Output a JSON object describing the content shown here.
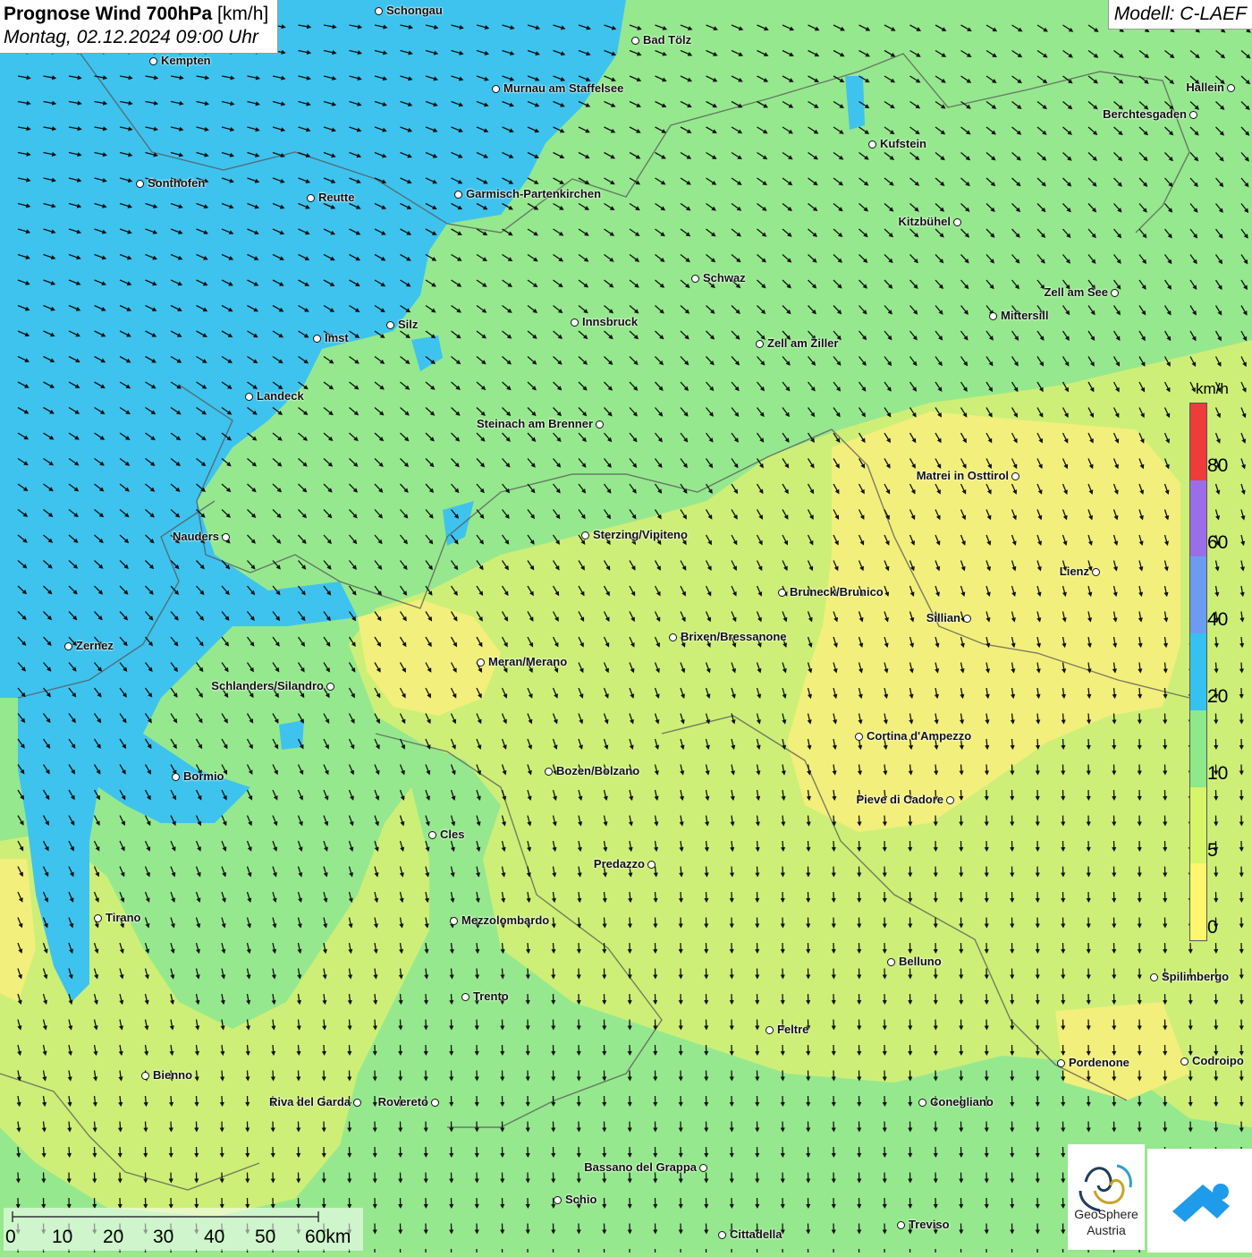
{
  "header": {
    "title_bold": "Prognose Wind 700hPa",
    "title_unit": "[km/h]",
    "datetime": "Montag, 02.12.2024 09:00 Uhr"
  },
  "model": {
    "label": "Modell: C-LAEF"
  },
  "legend": {
    "unit": "km/h",
    "levels": [
      "0",
      "5",
      "10",
      "20",
      "40",
      "60",
      "80"
    ],
    "colors": [
      "#fdf66e",
      "#d8f46a",
      "#8ee98a",
      "#35c2f0",
      "#6b9cf2",
      "#9c6de8",
      "#ee3b3b"
    ]
  },
  "scale_bar": {
    "labels": [
      "0",
      "10",
      "20",
      "30",
      "40",
      "50",
      "60km"
    ]
  },
  "logos": {
    "geosphere_line1": "GeoSphere",
    "geosphere_line2": "Austria"
  },
  "map_colors": {
    "blue": "#3ec3ee",
    "green": "#96e88e",
    "green_dark": "#86e28a",
    "lime": "#cdef78",
    "yellow": "#f2ef7c"
  },
  "cities": [
    {
      "name": "Schongau",
      "label_side": "right"
    },
    {
      "name": "Bad Tölz",
      "label_side": "right"
    },
    {
      "name": "Kempten",
      "label_side": "right"
    },
    {
      "name": "Murnau am Staffelsee",
      "label_side": "right"
    },
    {
      "name": "Hallein",
      "label_side": "left"
    },
    {
      "name": "Berchtesgaden",
      "label_side": "left"
    },
    {
      "name": "Kufstein",
      "label_side": "right"
    },
    {
      "name": "Sonthofen",
      "label_side": "right"
    },
    {
      "name": "Reutte",
      "label_side": "right"
    },
    {
      "name": "Garmisch-Partenkirchen",
      "label_side": "right"
    },
    {
      "name": "Kitzbühel",
      "label_side": "left"
    },
    {
      "name": "Schwaz",
      "label_side": "right"
    },
    {
      "name": "Zell am See",
      "label_side": "left"
    },
    {
      "name": "Mittersill",
      "label_side": "right"
    },
    {
      "name": "Innsbruck",
      "label_side": "right"
    },
    {
      "name": "Silz",
      "label_side": "right"
    },
    {
      "name": "Imst",
      "label_side": "right"
    },
    {
      "name": "Zell am Ziller",
      "label_side": "right"
    },
    {
      "name": "Landeck",
      "label_side": "right"
    },
    {
      "name": "Steinach am Brenner",
      "label_side": "left"
    },
    {
      "name": "Matrei in Osttirol",
      "label_side": "left"
    },
    {
      "name": "Nauders",
      "label_side": "left"
    },
    {
      "name": "Sterzing/Vipiteno",
      "label_side": "right"
    },
    {
      "name": "Lienz",
      "label_side": "left"
    },
    {
      "name": "Bruneck/Brunico",
      "label_side": "right"
    },
    {
      "name": "Sillian",
      "label_side": "left"
    },
    {
      "name": "Zernez",
      "label_side": "right"
    },
    {
      "name": "Brixen/Bressanone",
      "label_side": "right"
    },
    {
      "name": "Meran/Merano",
      "label_side": "right"
    },
    {
      "name": "Schlanders/Silandro",
      "label_side": "left"
    },
    {
      "name": "Cortina d'Ampezzo",
      "label_side": "right"
    },
    {
      "name": "Bozen/Bolzano",
      "label_side": "right"
    },
    {
      "name": "Bormio",
      "label_side": "right"
    },
    {
      "name": "Pieve di Cadore",
      "label_side": "left"
    },
    {
      "name": "Cles",
      "label_side": "right"
    },
    {
      "name": "Predazzo",
      "label_side": "left"
    },
    {
      "name": "Tirano",
      "label_side": "right"
    },
    {
      "name": "Mezzolombardo",
      "label_side": "right"
    },
    {
      "name": "Belluno",
      "label_side": "right"
    },
    {
      "name": "Spilimbergo",
      "label_side": "right"
    },
    {
      "name": "Trento",
      "label_side": "right"
    },
    {
      "name": "Feltre",
      "label_side": "right"
    },
    {
      "name": "Pordenone",
      "label_side": "right"
    },
    {
      "name": "Codroipo",
      "label_side": "right"
    },
    {
      "name": "Bienno",
      "label_side": "right"
    },
    {
      "name": "Riva del Garda",
      "label_side": "left"
    },
    {
      "name": "Rovereto",
      "label_side": "left"
    },
    {
      "name": "Conegliano",
      "label_side": "right"
    },
    {
      "name": "Bassano del Grappa",
      "label_side": "left"
    },
    {
      "name": "Schio",
      "label_side": "right"
    },
    {
      "name": "Treviso",
      "label_side": "right"
    },
    {
      "name": "Cittadella",
      "label_side": "right"
    }
  ]
}
